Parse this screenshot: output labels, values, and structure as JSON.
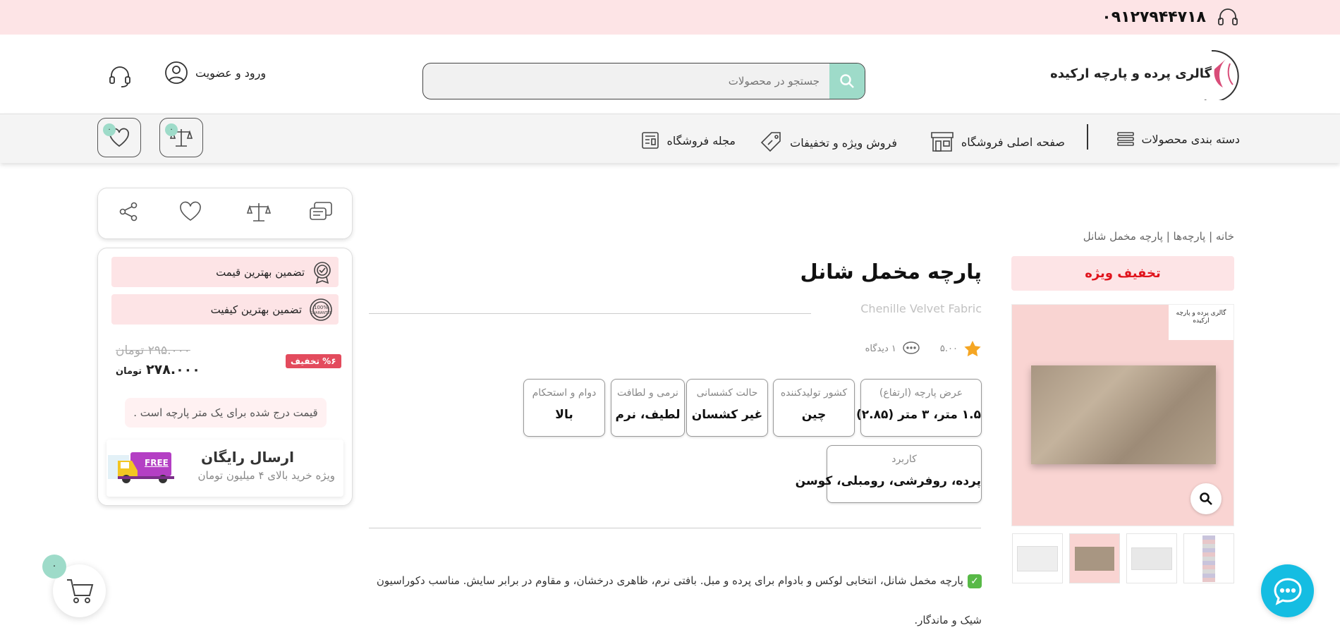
{
  "topbar": {
    "phone": "۰۹۱۲۷۹۴۴۷۱۸"
  },
  "header": {
    "logo_text": "گالری پرده و پارچه ارکیده",
    "search_placeholder": "جستجو در محصولات",
    "login_label": "ورود و عضویت"
  },
  "nav": {
    "categories": "دسته بندی محصولات",
    "home": "صفحه اصلی فروشگاه",
    "sale": "فروش ویژه و تخفیفات",
    "magazine": "مجله فروشگاه",
    "compare_count": "۰",
    "wishlist_count": "۰"
  },
  "breadcrumb": "خانه | پارچه‌ها | پارچه مخمل شانل",
  "gallery": {
    "special_label": "تخفیف ویژه",
    "image_logo_text": "گالری پرده و پارچه ارکیده"
  },
  "product": {
    "title": "پارچه مخمل شانل",
    "subtitle": "Chenille Velvet Fabric",
    "rating": "۵.۰۰",
    "views": "۱ دیدگاه",
    "attributes": [
      {
        "key": "عرض پارچه (ارتفاع)",
        "value": "۱.۵ متر، ۳ متر (۲.۸۵)"
      },
      {
        "key": "کشور تولیدکننده",
        "value": "چین"
      },
      {
        "key": "حالت کشسانی",
        "value": "غیر کشسان"
      },
      {
        "key": "نرمی و لطافت",
        "value": "لطیف، نرم"
      },
      {
        "key": "دوام و استحکام",
        "value": "بالا"
      },
      {
        "key": "کاربرد",
        "value": "پرده، روفرشی، رومبلی، کوسن"
      }
    ],
    "description": "پارچه مخمل شانل، انتخابی لوکس و بادوام برای پرده و مبل. بافتی نرم، ظاهری درخشان، و مقاوم در برابر سایش. مناسب دکوراسیون شیک و ماندگار."
  },
  "sidebar": {
    "best_price": "تضمین بهترین قیمت",
    "best_quality": "تضمین بهترین کیفیت",
    "discount": "%۶ تخفیف",
    "old_price": "۲۹۵.۰۰۰ تومان",
    "new_price": "۲۷۸.۰۰۰",
    "currency": "تومان",
    "note": "قیمت درج شده برای یک متر پارچه است .",
    "shipping_title": "ارسال  رایگان",
    "shipping_sub": "ویژه خرید بالای ۴ میلیون تومان",
    "free_label": "FREE"
  },
  "cart": {
    "count": "۰"
  },
  "colors": {
    "pink_bg": "#fde4e6",
    "mint": "#9edbc9",
    "red": "#e0141d",
    "chat_blue": "#15bde2"
  }
}
